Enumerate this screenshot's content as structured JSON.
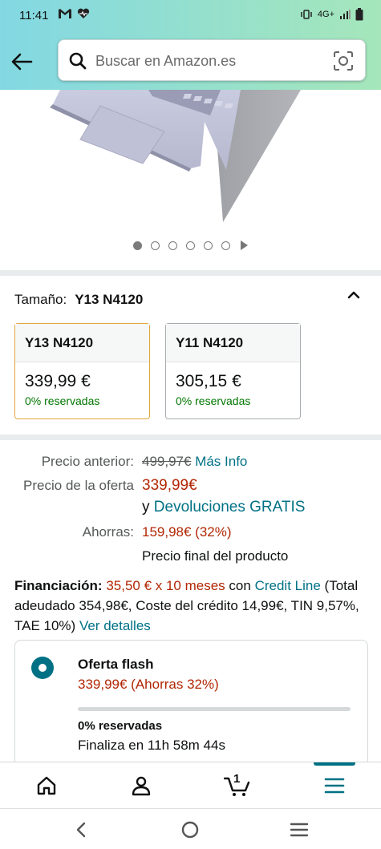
{
  "status_bar": {
    "time": "11:41",
    "network": "4G+",
    "icons": [
      "gmail-icon",
      "health-icon",
      "vibrate-icon",
      "signal-icon",
      "battery-icon"
    ]
  },
  "header": {
    "search_placeholder": "Buscar en Amazon.es"
  },
  "carousel": {
    "image_count": 6,
    "active_index": 0
  },
  "size_selector": {
    "label": "Tamaño:",
    "selected": "Y13 N4120",
    "options": [
      {
        "name": "Y13 N4120",
        "price": "339,99 €",
        "reserved": "0% reservadas"
      },
      {
        "name": "Y11 N4120",
        "price": "305,15 €",
        "reserved": "0% reservadas"
      }
    ]
  },
  "pricing": {
    "previous_label": "Precio anterior:",
    "previous_value": "499,97€",
    "more_info": "Más Info",
    "offer_label": "Precio de la oferta",
    "offer_value": "339,99€",
    "returns_prefix": "y",
    "returns_link": "Devoluciones GRATIS",
    "savings_label": "Ahorras:",
    "savings_value": "159,98€ (32%)",
    "final_note": "Precio final del producto"
  },
  "financing": {
    "label": "Financiación:",
    "plan": "35,50 € x 10 meses",
    "with": "con",
    "provider": "Credit Line",
    "details": "(Total adeudado 354,98€, Coste del crédito 14,99€, TIN 9,57%, TAE 10%)",
    "details_link": "Ver detalles"
  },
  "flash_offer": {
    "title": "Oferta flash",
    "price": "339,99€ (Ahorras 32%)",
    "progress_percent": 0,
    "reserved": "0% reservadas",
    "ends": "Finaliza en 11h 58m 44s"
  },
  "bottom_nav": {
    "cart_count": "1"
  },
  "colors": {
    "accent": "#007185",
    "price_red": "#b12704",
    "green": "#007600",
    "selected_border": "#e3a63f"
  }
}
